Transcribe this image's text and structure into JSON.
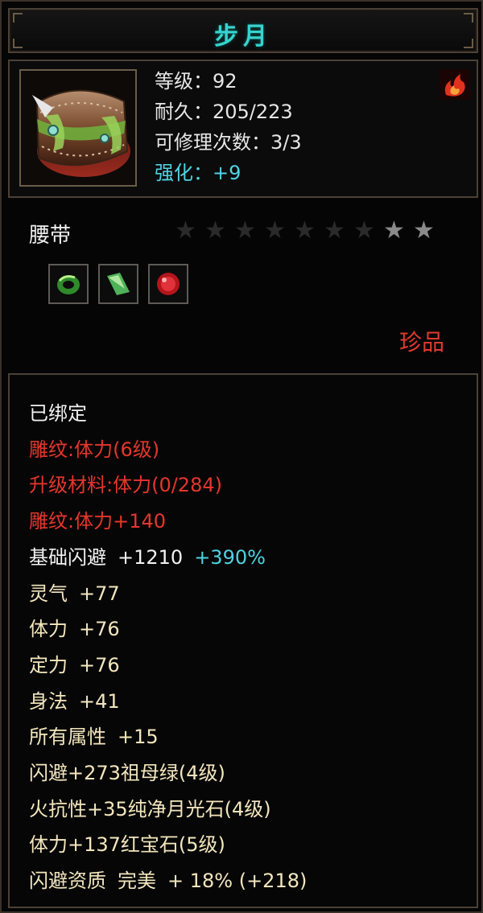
{
  "item": {
    "name": "步月",
    "type": "腰带",
    "rarity": "珍品",
    "stats": {
      "level_label": "等级：",
      "level_value": "92",
      "durability_label": "耐久：",
      "durability_value": "205/223",
      "repair_label": "可修理次数：",
      "repair_value": "3/3",
      "enhance_label": "强化：",
      "enhance_value": "+9"
    },
    "stars": {
      "total": 9,
      "lit": 2
    },
    "gem_slots": [
      "green-ring-gem-icon",
      "green-crystal-gem-icon",
      "red-ruby-gem-icon"
    ]
  },
  "attributes": {
    "bound": "已绑定",
    "engrave": "雕纹:体力(6级)",
    "upgrade_material": "升级材料:体力(0/284)",
    "engrave_bonus": "雕纹:体力+140",
    "base_dodge_label": "基础闪避",
    "base_dodge_value": "+1210",
    "base_dodge_pct": "+390%",
    "lingqi_label": "灵气",
    "lingqi_value": "+77",
    "tili_label": "体力",
    "tili_value": "+76",
    "dingli_label": "定力",
    "dingli_value": "+76",
    "shenfa_label": "身法",
    "shenfa_value": "+41",
    "all_label": "所有属性",
    "all_value": "+15",
    "gem1": "闪避+273祖母绿(4级)",
    "gem2": "火抗性+35纯净月光石(4级)",
    "gem3": "体力+137红宝石(5级)",
    "aptitude_label": "闪避资质",
    "aptitude_grade": "完美",
    "aptitude_value": "+ 18% (+218)"
  },
  "colors": {
    "title": "#36d4cf",
    "red_text": "#e5362c",
    "cream_text": "#f3e6bd",
    "cyan_text": "#4fd3e3",
    "border": "#4b4136"
  }
}
